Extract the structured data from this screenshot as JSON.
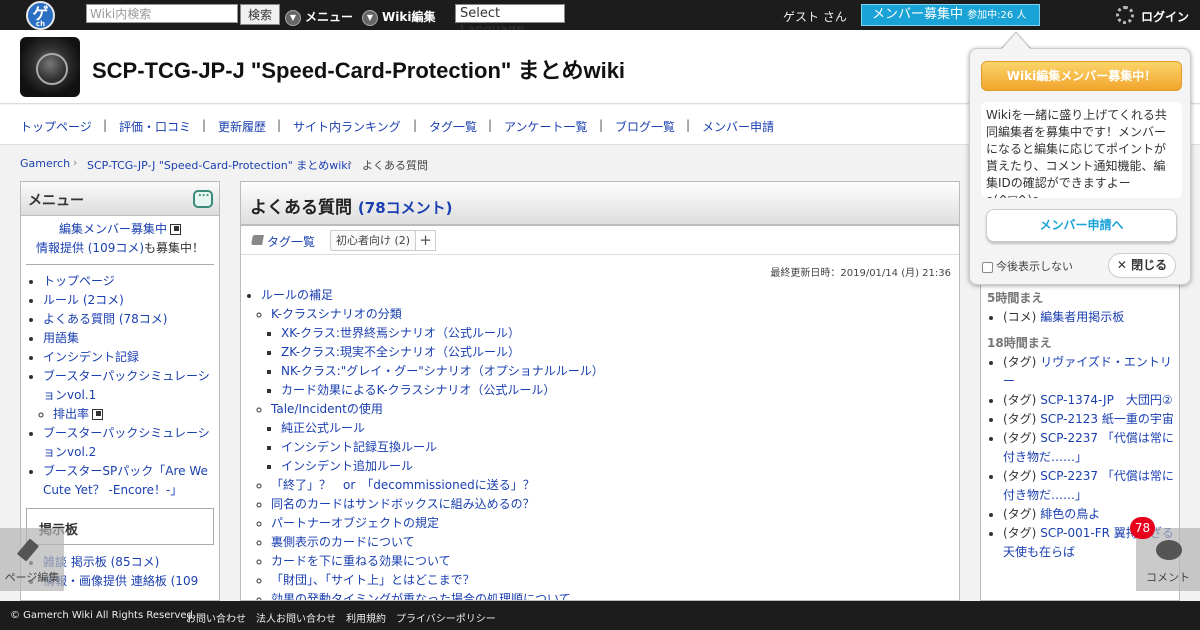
{
  "topbar": {
    "logo_text": "ゲ",
    "logo_sub": "ch",
    "search_placeholder": "Wiki内検索",
    "search_button": "検索",
    "menu_label": "メニュー",
    "edit_label": "Wiki編集",
    "language_select": "Select Language",
    "guest_text": "ゲスト さん",
    "recruit_label": "メンバー募集中",
    "recruit_count": "参加中:26 人",
    "login_label": "ログイン"
  },
  "header": {
    "title": "SCP-TCG-JP-J \"Speed-Card-Protection\" まとめwiki"
  },
  "nav": {
    "items": [
      "トップページ",
      "評価・口コミ",
      "更新履歴",
      "サイト内ランキング",
      "タグ一覧",
      "アンケート一覧",
      "ブログ一覧",
      "メンバー申請"
    ],
    "separator": "|"
  },
  "breadcrumb": {
    "items": [
      "Gamerch",
      "SCP-TCG-JP-J \"Speed-Card-Protection\" まとめwiki",
      "よくある質問"
    ],
    "separator": "›"
  },
  "sidebar": {
    "title": "メニュー",
    "promo_line1": "編集メンバー募集中",
    "promo_line2a": "情報提供 (109コメ)",
    "promo_line2b": "も募集中！",
    "items": [
      "トップページ",
      "ルール (2コメ)",
      "よくある質問 (78コメ)",
      "用語集",
      "インシデント記録",
      "ブースターパックシミュレーションvol.1",
      "排出率",
      "ブースターパックシミュレーションvol.2",
      "ブースターSPパック「Are We Cute Yet？ -Encore！-」"
    ],
    "board_title": "掲示板",
    "board_items": [
      "雑談 掲示板 (85コメ)",
      "情報・画像提供 連絡板 (109"
    ]
  },
  "main": {
    "title": "よくある質問",
    "comment_count": "(78コメント)",
    "tag_list_label": "タグ一覧",
    "tag_chip": "初心者向け (2)",
    "tag_add": "+",
    "updated": "最終更新日時：2019/01/14 (月) 21:36",
    "toc": {
      "l1_rules": "ルールの補足",
      "k_class": "K-クラスシナリオの分類",
      "xk": "XK-クラス:世界終焉シナリオ（公式ルール）",
      "zk": "ZK-クラス:現実不全シナリオ（公式ルール）",
      "nk": "NK-クラス:\"グレイ・グー\"シナリオ（オプショナルルール）",
      "card_k": "カード効果によるK-クラスシナリオ（公式ルール）",
      "tale": "Tale/Incidentの使用",
      "pure": "純正公式ルール",
      "incident_swap": "インシデント記録互換ルール",
      "incident_add": "インシデント追加ルール",
      "q1": "「終了」？　or　「decommissionedに送る」？",
      "q2": "同名のカードはサンドボックスに組み込めるの？",
      "q3": "パートナーオブジェクトの規定",
      "q4": "裏側表示のカードについて",
      "q5": "カードを下に重ねる効果について",
      "q6": "「財団」、「サイト上」とはどこまで？",
      "q7": "効果の発動タイミングが重なった場合の処理順について"
    }
  },
  "right": {
    "t1": "5時間まえ",
    "t1_items": [
      {
        "pref": "(コメ)",
        "text": "編集者用掲示板"
      }
    ],
    "t2": "18時間まえ",
    "t2_items": [
      {
        "pref": "(タグ)",
        "text": "リヴァイズド・エントリー"
      },
      {
        "pref": "(タグ)",
        "text": "SCP-1374-JP　大団円②"
      },
      {
        "pref": "(タグ)",
        "text": "SCP-2123 紙一重の宇宙"
      },
      {
        "pref": "(タグ)",
        "text": "SCP-2237 「代償は常に付き物だ……」"
      },
      {
        "pref": "(タグ)",
        "text": "SCP-2237 「代償は常に付き物だ……」"
      },
      {
        "pref": "(タグ)",
        "text": "緋色の鳥よ"
      },
      {
        "pref": "(タグ)",
        "text": "SCP-001-FR 翼持たざる天使も在らば"
      }
    ]
  },
  "popup": {
    "title": "Wiki編集メンバー募集中！",
    "body": "Wikiを一緒に盛り上げてくれる共同編集者を募集中です！メンバーになると編集に応じてポイントが貰えたり、コメント通知機能、編集IDの確認ができますよーo(^▽^)o",
    "apply": "メンバー申請へ",
    "no_show": "今後表示しない",
    "close": "閉じる"
  },
  "floating": {
    "left_label": "ページ編集",
    "right_label": "コメント",
    "count": "78"
  },
  "footer": {
    "copyright": "© Gamerch Wiki All Rights Reserved.",
    "links": [
      "お問い合わせ",
      "法人お問い合わせ",
      "利用規約",
      "プライバシーポリシー"
    ]
  }
}
